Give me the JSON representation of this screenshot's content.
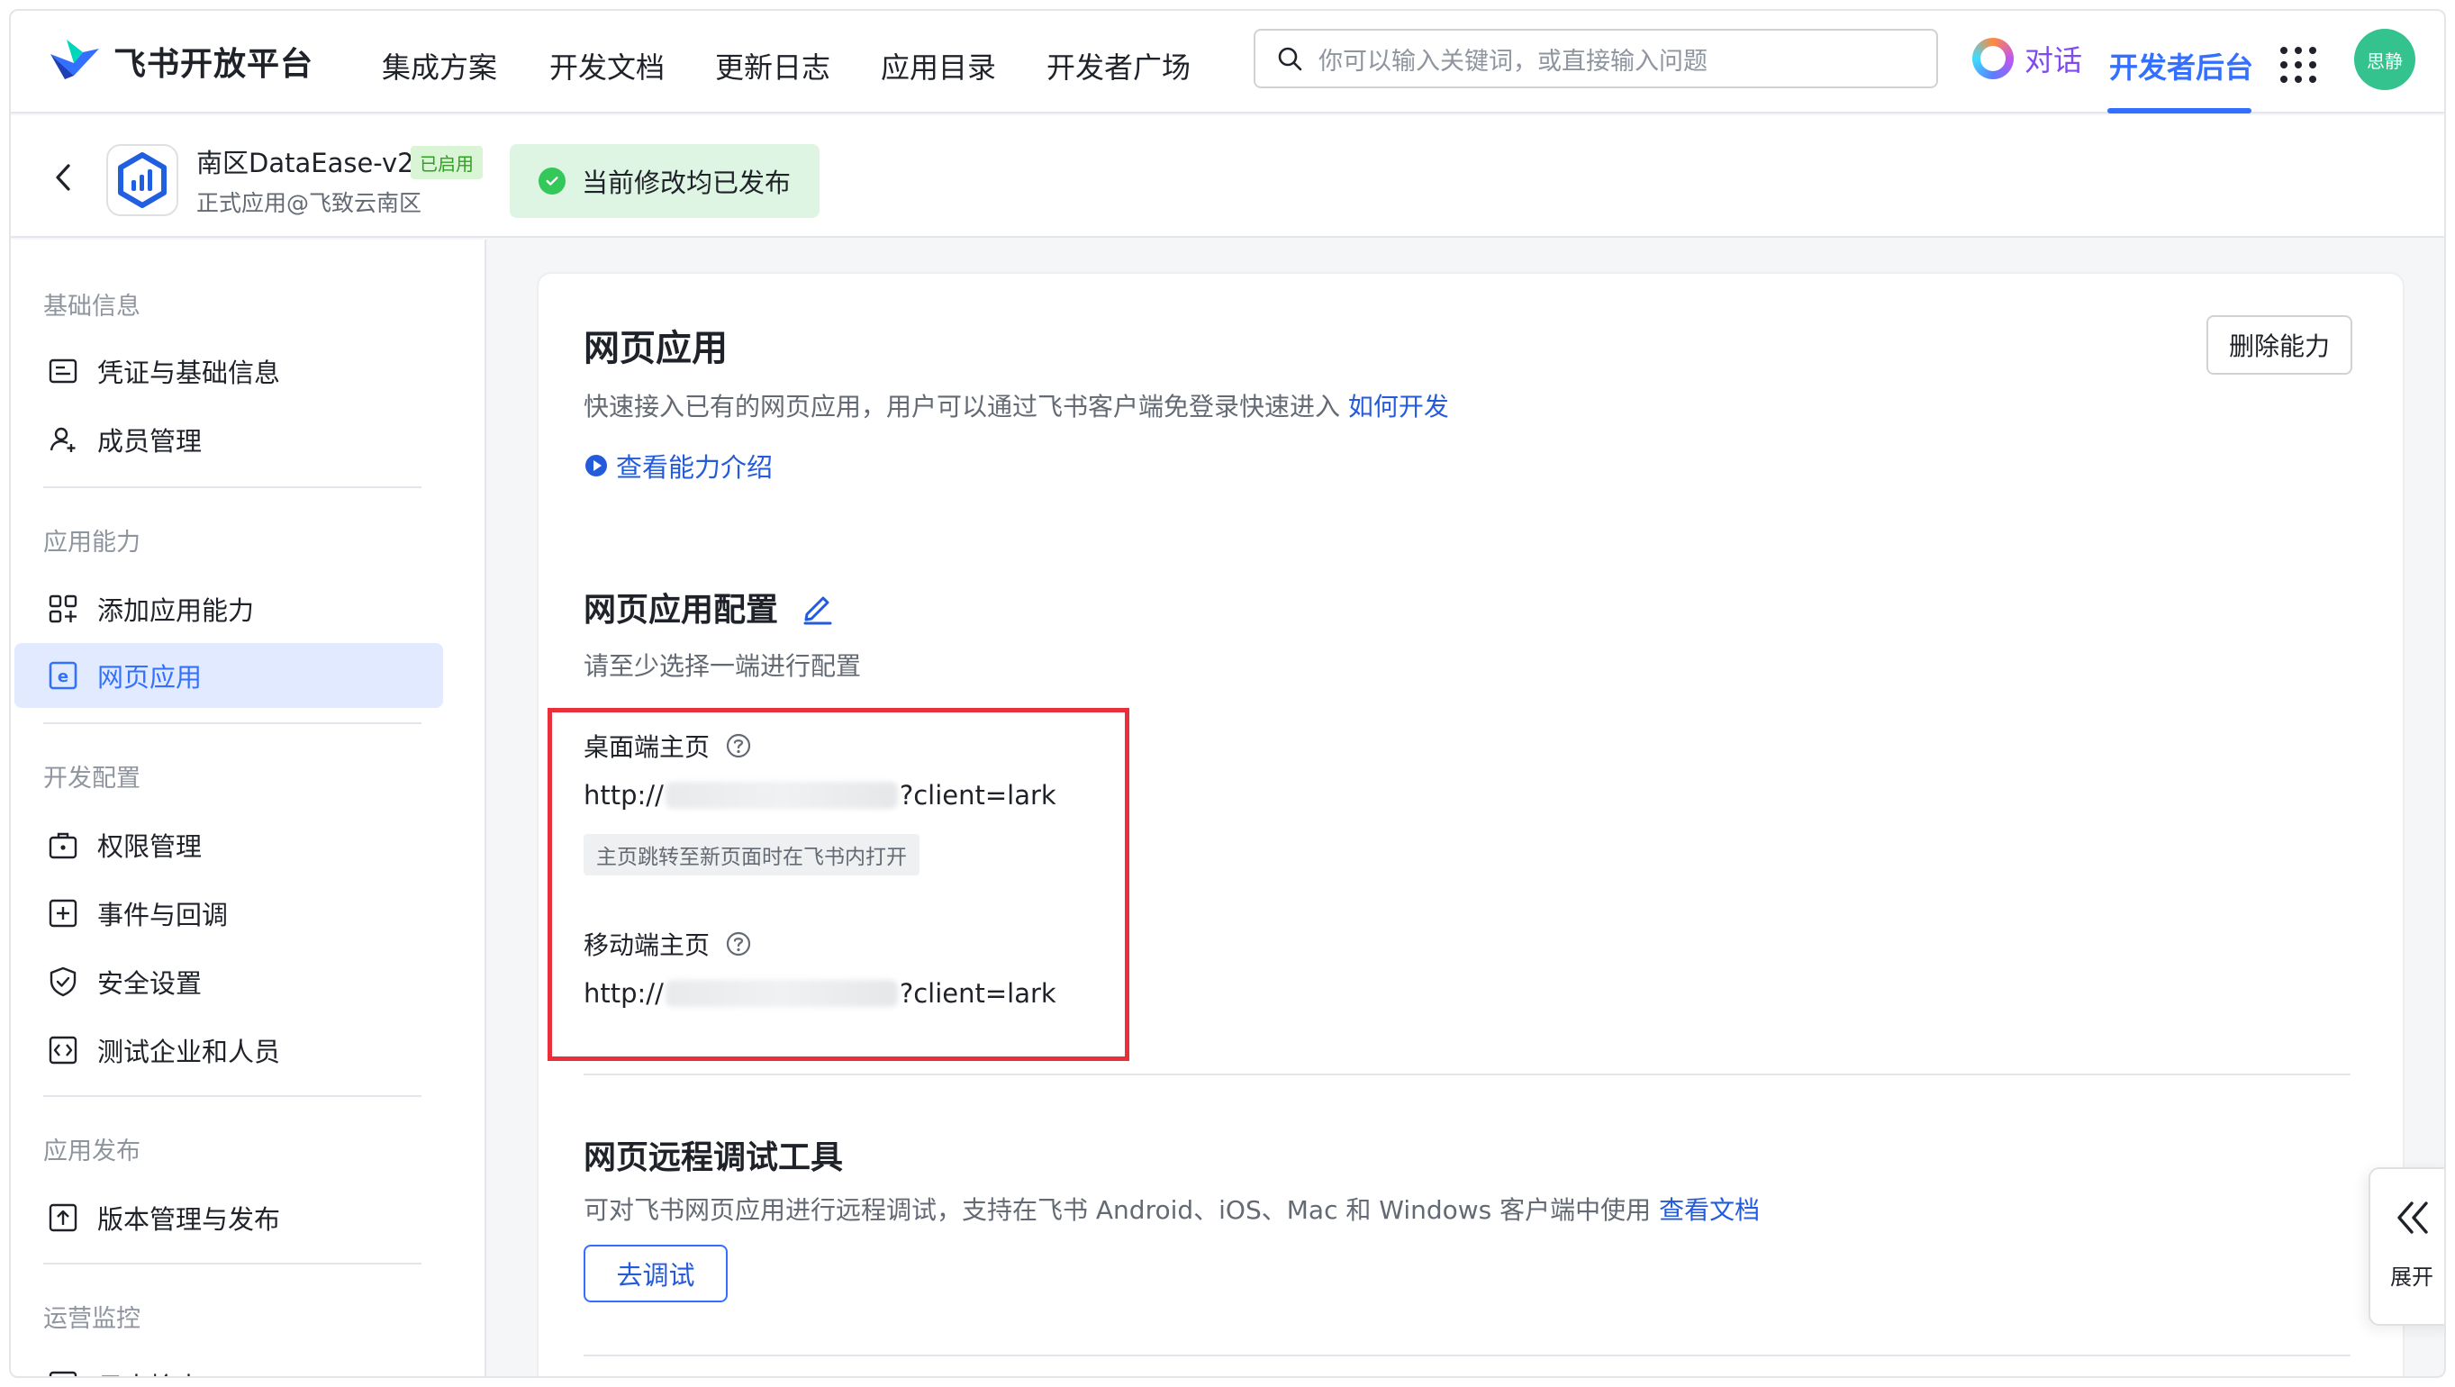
{
  "brand": {
    "name": "飞书开放平台"
  },
  "nav": {
    "items": [
      "集成方案",
      "开发文档",
      "更新日志",
      "应用目录",
      "开发者广场"
    ],
    "search_placeholder": "你可以输入关键词，或直接输入问题",
    "chat_label": "对话",
    "dev_console": "开发者后台",
    "avatar_text": "思静"
  },
  "app": {
    "name": "南区DataEase-v2",
    "status_badge": "已启用",
    "subtitle": "正式应用@飞致云南区",
    "publish_status": "当前修改均已发布"
  },
  "sidebar": {
    "groups": {
      "basic": "基础信息",
      "capability": "应用能力",
      "dev": "开发配置",
      "release": "应用发布",
      "monitor": "运营监控"
    },
    "items": {
      "credentials": "凭证与基础信息",
      "members": "成员管理",
      "add_capability": "添加应用能力",
      "web_app": "网页应用",
      "permissions": "权限管理",
      "events": "事件与回调",
      "security": "安全设置",
      "test_org": "测试企业和人员",
      "versions": "版本管理与发布",
      "logs": "日志检索"
    }
  },
  "main": {
    "title": "网页应用",
    "description": "快速接入已有的网页应用，用户可以通过飞书客户端免登录快速进入",
    "how_to_link": "如何开发",
    "intro_link": "查看能力介绍",
    "delete_button": "删除能力",
    "config": {
      "title": "网页应用配置",
      "hint": "请至少选择一端进行配置",
      "desktop_label": "桌面端主页",
      "desktop_url_prefix": "http://",
      "desktop_url_suffix": "?client=lark",
      "desktop_tag": "主页跳转至新页面时在飞书内打开",
      "mobile_label": "移动端主页",
      "mobile_url_prefix": "http://",
      "mobile_url_suffix": "?client=lark"
    },
    "debug": {
      "title": "网页远程调试工具",
      "description": "可对飞书网页应用进行远程调试，支持在飞书 Android、iOS、Mac 和 Windows 客户端中使用",
      "doc_link": "查看文档",
      "button": "去调试"
    }
  },
  "expand_label": "展开",
  "colors": {
    "accent": "#3370ff",
    "highlight": "#e9303a",
    "success": "#34c759"
  }
}
